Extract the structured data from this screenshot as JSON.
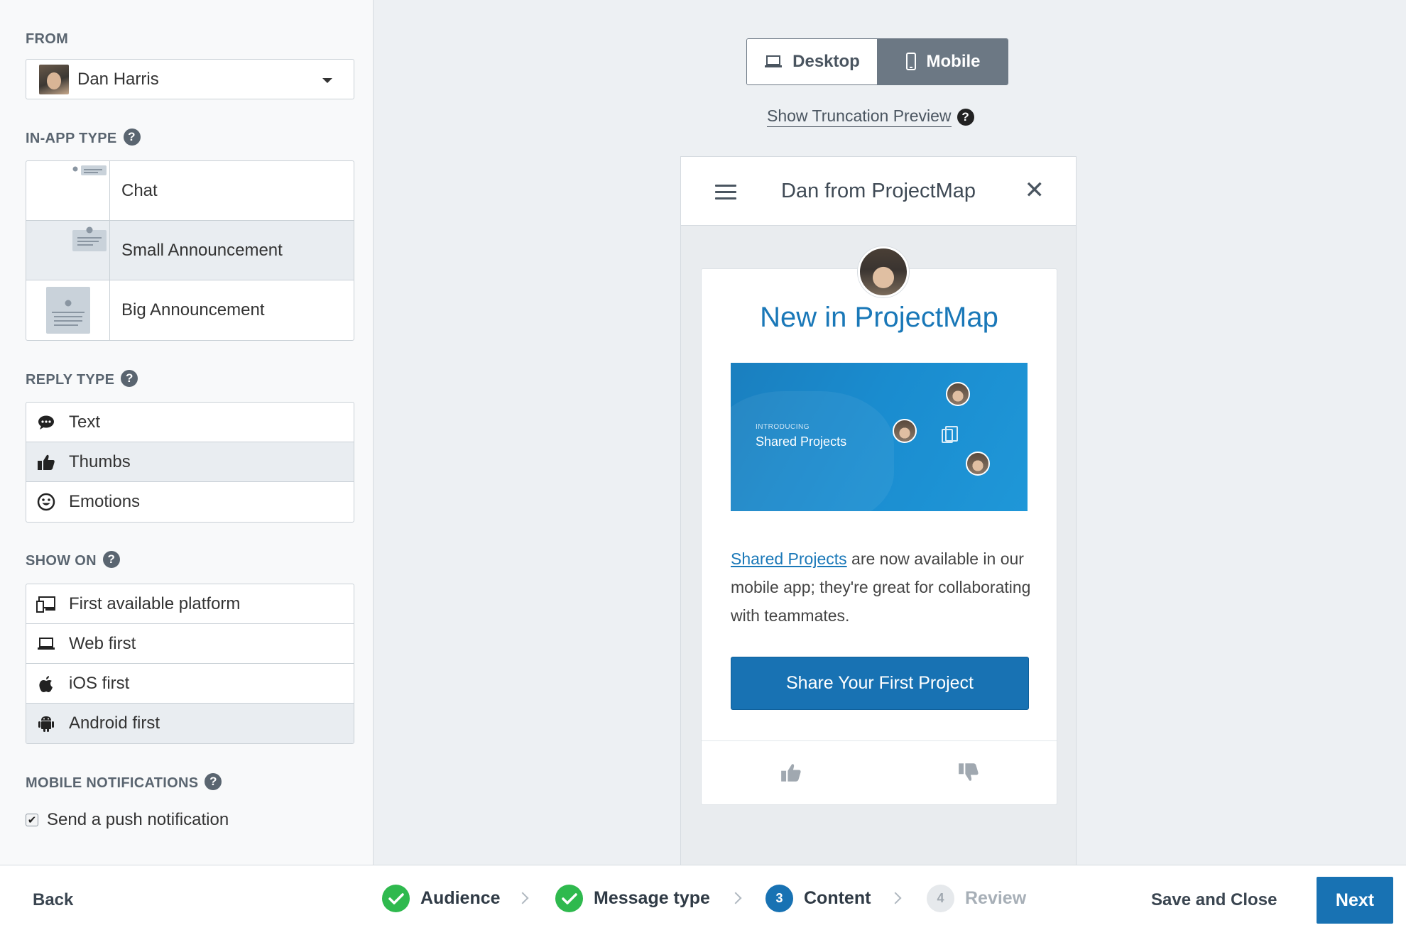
{
  "sidebar": {
    "from": {
      "label": "FROM",
      "selected": "Dan Harris"
    },
    "in_app_type": {
      "label": "IN-APP TYPE",
      "help": "?",
      "options": [
        {
          "label": "Chat",
          "selected": false
        },
        {
          "label": "Small Announcement",
          "selected": true
        },
        {
          "label": "Big Announcement",
          "selected": false
        }
      ]
    },
    "reply_type": {
      "label": "REPLY TYPE",
      "help": "?",
      "options": [
        {
          "label": "Text",
          "icon": "speech-bubble-icon",
          "selected": false
        },
        {
          "label": "Thumbs",
          "icon": "thumbs-up-icon",
          "selected": true
        },
        {
          "label": "Emotions",
          "icon": "smiley-icon",
          "selected": false
        }
      ]
    },
    "show_on": {
      "label": "SHOW ON",
      "help": "?",
      "options": [
        {
          "label": "First available platform",
          "icon": "multi-device-icon",
          "selected": false
        },
        {
          "label": "Web first",
          "icon": "laptop-icon",
          "selected": false
        },
        {
          "label": "iOS first",
          "icon": "apple-icon",
          "selected": false
        },
        {
          "label": "Android first",
          "icon": "android-icon",
          "selected": true
        }
      ]
    },
    "mobile_notifications": {
      "label": "MOBILE NOTIFICATIONS",
      "help": "?",
      "push_label": "Send a push notification",
      "push_checked": true,
      "check_glyph": "✔"
    }
  },
  "preview": {
    "toggle": {
      "desktop": "Desktop",
      "mobile": "Mobile",
      "active": "Mobile"
    },
    "truncation_link": "Show Truncation Preview",
    "truncation_help": "?",
    "phone": {
      "header_title": "Dan from ProjectMap",
      "close_glyph": "✕",
      "card": {
        "title": "New in ProjectMap",
        "image": {
          "intro": "INTRODUCING",
          "heading": "Shared Projects"
        },
        "body_link": "Shared Projects",
        "body_text": " are now available in our mobile app; they're great for collaborating with teammates.",
        "cta": "Share Your First Project"
      }
    }
  },
  "footer": {
    "back": "Back",
    "steps": [
      {
        "label": "Audience",
        "status": "done"
      },
      {
        "label": "Message type",
        "status": "done"
      },
      {
        "number": "3",
        "label": "Content",
        "status": "current"
      },
      {
        "number": "4",
        "label": "Review",
        "status": "todo"
      }
    ],
    "save_close": "Save and Close",
    "next": "Next"
  },
  "colors": {
    "accent": "#1872b3",
    "success": "#2fb94e",
    "link": "#1a78b8"
  }
}
